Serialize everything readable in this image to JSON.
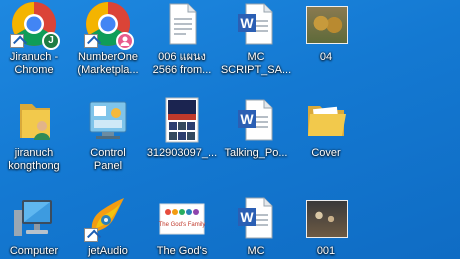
{
  "desktop": {
    "icons": [
      {
        "label": "Jiranuch -\nChrome",
        "icon": "chrome-icon",
        "badge": "J"
      },
      {
        "label": "NumberOne\n(Marketpla...",
        "icon": "chrome-icon"
      },
      {
        "label": "006 แผนง\n2566 from...",
        "icon": "document-icon"
      },
      {
        "label": "MC\nSCRIPT_SA...",
        "icon": "word-document-icon",
        "word_letter": "W"
      },
      {
        "label": "04",
        "icon": "photo-thumbnail-icon"
      },
      {
        "label": "jiranuch\nkongthong",
        "icon": "user-folder-icon"
      },
      {
        "label": "Control\nPanel",
        "icon": "control-panel-icon"
      },
      {
        "label": "312903097_...",
        "icon": "image-thumbnail-icon"
      },
      {
        "label": "Talking_Po...",
        "icon": "word-document-icon",
        "word_letter": "W"
      },
      {
        "label": "Cover",
        "icon": "folder-icon"
      },
      {
        "label": "Computer",
        "icon": "computer-icon"
      },
      {
        "label": "jetAudio",
        "icon": "jetaudio-icon"
      },
      {
        "label": "The God's",
        "icon": "image-thumbnail-icon",
        "thumb_text": "The God's Family"
      },
      {
        "label": "MC",
        "icon": "word-document-icon",
        "word_letter": "W"
      },
      {
        "label": "001",
        "icon": "photo-thumbnail-icon"
      }
    ]
  },
  "colors": {
    "desktop_background": "#1479d2",
    "label_text": "#ffffff",
    "word_blue": "#2b5fb4",
    "folder_yellow": "#f2c94c"
  }
}
